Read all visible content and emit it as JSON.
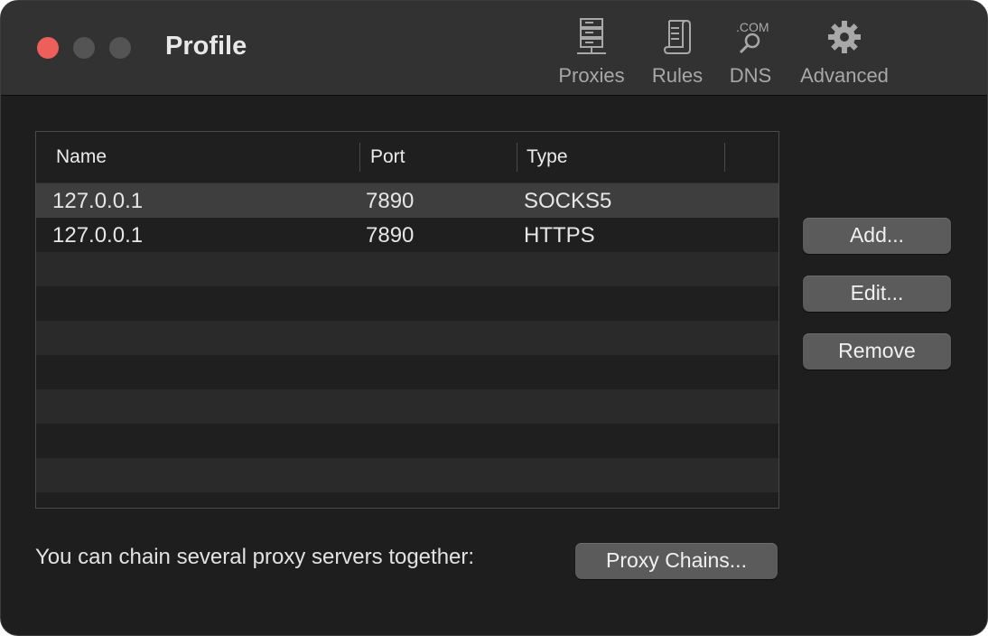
{
  "window": {
    "title": "Profile"
  },
  "toolbar": {
    "items": [
      {
        "label": "Proxies",
        "icon": "server-stack-icon"
      },
      {
        "label": "Rules",
        "icon": "scroll-icon"
      },
      {
        "label": "DNS",
        "icon": "dns-magnifier-icon",
        "icon_text": ".COM"
      },
      {
        "label": "Advanced",
        "icon": "gear-icon"
      }
    ]
  },
  "table": {
    "columns": [
      "Name",
      "Port",
      "Type"
    ],
    "rows": [
      {
        "name": "127.0.0.1",
        "port": "7890",
        "type": "SOCKS5"
      },
      {
        "name": "127.0.0.1",
        "port": "7890",
        "type": "HTTPS"
      }
    ]
  },
  "buttons": {
    "add": "Add...",
    "edit": "Edit...",
    "remove": "Remove",
    "proxy_chains": "Proxy Chains..."
  },
  "footer": {
    "chain_text": "You can chain several proxy servers together:"
  },
  "colors": {
    "close": "#ec5f5b",
    "window_bg": "#1e1e1e",
    "titlebar_bg": "#323232",
    "button_bg": "#5b5b5b"
  }
}
